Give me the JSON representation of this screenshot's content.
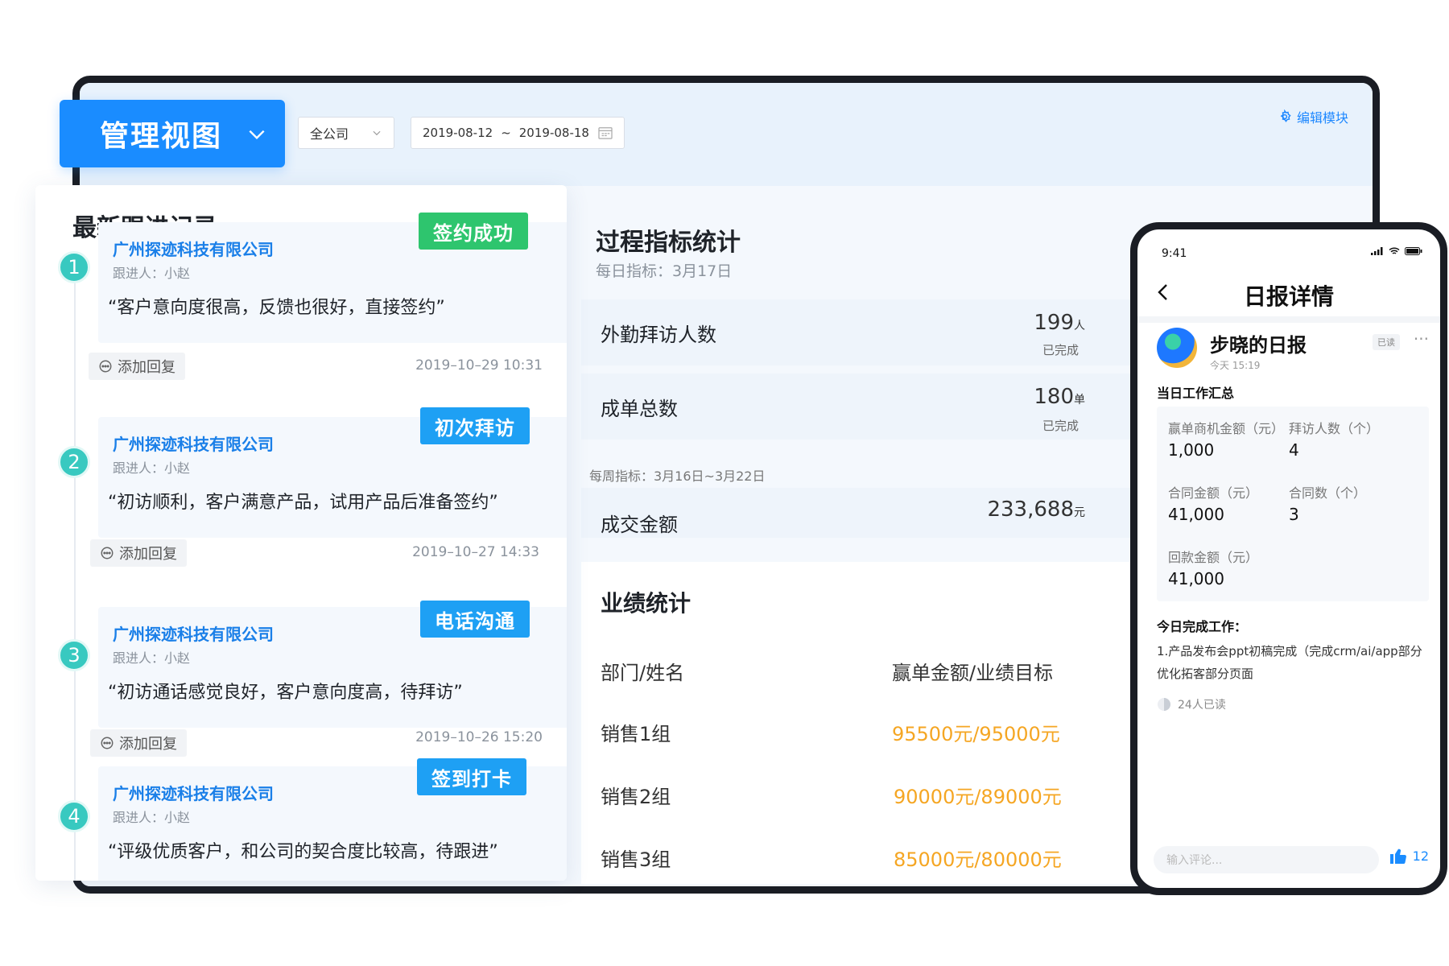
{
  "header": {
    "view_label": "管理视图",
    "company_filter": "全公司",
    "date_start": "2019-08-12",
    "date_sep": "~",
    "date_end": "2019-08-18",
    "edit_module": "编辑模块"
  },
  "followup": {
    "title": "最新跟进记录",
    "reply_label": "添加回复",
    "items": [
      {
        "num": "1",
        "company": "广州探迹科技有限公司",
        "follower": "跟进人：小赵",
        "tag": "签约成功",
        "quote": "“客户意向度很高，反馈也很好，直接签约”",
        "time": "2019–10–29 10:31"
      },
      {
        "num": "2",
        "company": "广州探迹科技有限公司",
        "follower": "跟进人：小赵",
        "tag": "初次拜访",
        "quote": "“初访顺利，客户满意产品，试用产品后准备签约”",
        "time": "2019–10–27 14:33"
      },
      {
        "num": "3",
        "company": "广州探迹科技有限公司",
        "follower": "跟进人：小赵",
        "tag": "电话沟通",
        "quote": "“初访通话感觉良好，客户意向度高，待拜访”",
        "time": "2019–10–26 15:20"
      },
      {
        "num": "4",
        "company": "广州探迹科技有限公司",
        "follower": "跟进人：小赵",
        "tag": "签到打卡",
        "quote": "“评级优质客户，和公司的契合度比较高，待跟进”",
        "time": ""
      }
    ]
  },
  "process": {
    "title": "过程指标统计",
    "daily_label": "每日指标：3月17日",
    "rows": [
      {
        "label": "外勤拜访人数",
        "value": "199",
        "unit": "人",
        "status": "已完成"
      },
      {
        "label": "成单总数",
        "value": "180",
        "unit": "单",
        "status": "已完成"
      }
    ],
    "weekly_label": "每周指标：3月16日~3月22日",
    "weekly_row": {
      "label": "成交金额",
      "value": "233,688",
      "unit": "元"
    }
  },
  "performance": {
    "title": "业绩统计",
    "col_name": "部门/姓名",
    "col_value": "赢单金额/业绩目标",
    "rows": [
      {
        "name": "销售1组",
        "value": "95500元/95000元"
      },
      {
        "name": "销售2组",
        "value": "90000元/89000元"
      },
      {
        "name": "销售3组",
        "value": "85000元/80000元"
      }
    ]
  },
  "phone": {
    "time": "9:41",
    "title": "日报详情",
    "report_name": "步晓的日报",
    "report_time": "今天 15:19",
    "read_badge": "已读",
    "summary_label": "当日工作汇总",
    "metrics": [
      {
        "label": "赢单商机金额（元）",
        "value": "1,000"
      },
      {
        "label": "拜访人数（个）",
        "value": "4"
      },
      {
        "label": "合同金额（元）",
        "value": "41,000"
      },
      {
        "label": "合同数（个）",
        "value": "3"
      },
      {
        "label": "回款金额（元）",
        "value": "41,000"
      }
    ],
    "done_label": "今日完成工作：",
    "done_text": "1.产品发布会ppt初稿完成（完成crm/ai/app部分优化拓客部分页面",
    "readers": "24人已读",
    "comment_placeholder": "输入评论...",
    "likes": "12"
  }
}
